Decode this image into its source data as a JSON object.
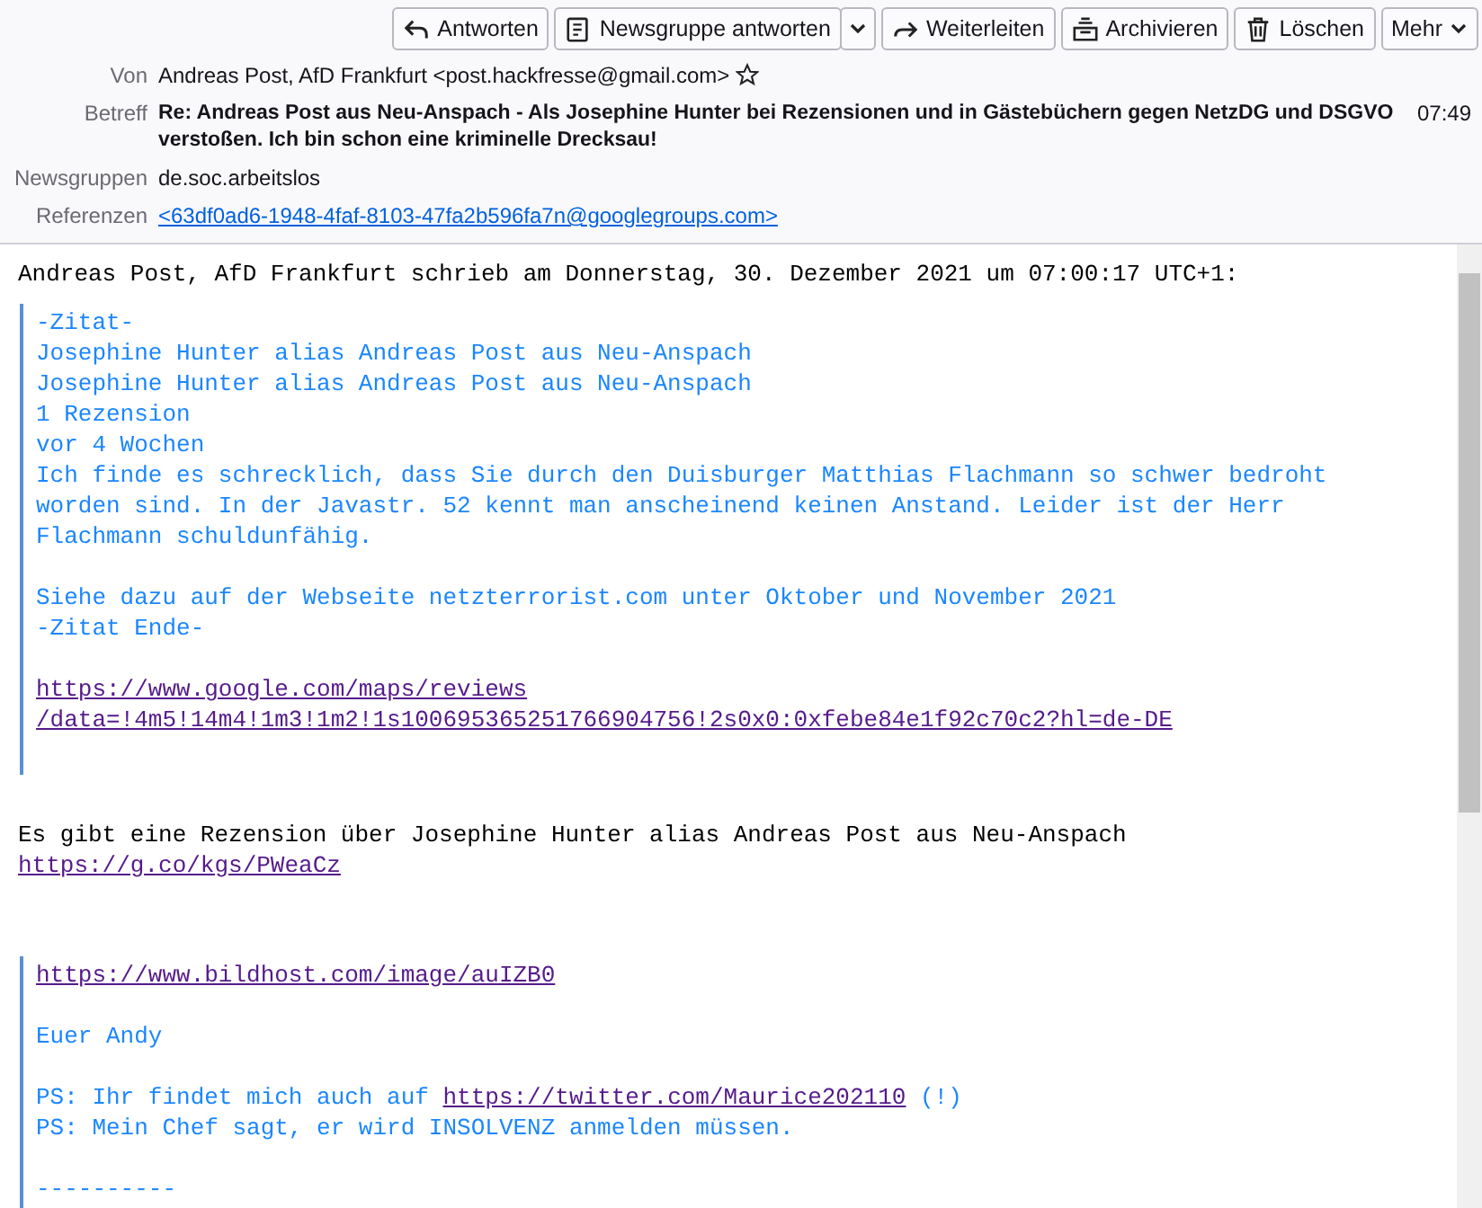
{
  "toolbar": [
    {
      "label": "Antworten"
    },
    {
      "label": "Newsgruppe antworten"
    },
    {
      "label": "Weiterleiten"
    },
    {
      "label": "Archivieren"
    },
    {
      "label": "Löschen"
    },
    {
      "label": "Mehr"
    }
  ],
  "headers": [
    {
      "label": "Von",
      "value": "Andreas Post, AfD Frankfurt <post.hackfresse@gmail.com>",
      "kind": "from",
      "starred": false
    },
    {
      "label": "Betreff",
      "value": "Re: Andreas Post aus Neu-Anspach - Als Josephine Hunter bei Rezensionen und in Gästebüchern gegen NetzDG und DSGVO verstoßen. Ich bin schon eine kriminelle Drecksau!",
      "kind": "subject",
      "time": "07:49"
    },
    {
      "label": "Newsgruppen",
      "value": "de.soc.arbeitslos",
      "kind": "plain"
    },
    {
      "label": "Referenzen",
      "value": "<63df0ad6-1948-4faf-8103-47fa2b596fa7n@googlegroups.com>",
      "kind": "link"
    }
  ],
  "body": [
    {
      "kind": "plain",
      "paragraphs": [
        [
          [
            {
              "text": "Andreas Post, AfD Frankfurt schrieb am Donnerstag, 30. Dezember 2021 um 07:00:17 UTC+1:",
              "kind": "text"
            }
          ]
        ]
      ]
    },
    {
      "kind": "quote",
      "paragraphs": [
        [
          [
            {
              "text": "-Zitat-",
              "kind": "text"
            }
          ],
          [
            {
              "text": "Josephine Hunter alias Andreas Post aus Neu-Anspach",
              "kind": "text"
            }
          ],
          [
            {
              "text": "Josephine Hunter alias Andreas Post aus Neu-Anspach",
              "kind": "text"
            }
          ],
          [
            {
              "text": "1 Rezension",
              "kind": "text"
            }
          ],
          [
            {
              "text": "vor 4 Wochen",
              "kind": "text"
            }
          ],
          [
            {
              "text": "Ich finde es schrecklich, dass Sie durch den Duisburger Matthias Flachmann so schwer bedroht",
              "kind": "text"
            }
          ],
          [
            {
              "text": "worden sind. In der Javastr. 52 kennt man anscheinend keinen Anstand. Leider ist der Herr",
              "kind": "text"
            }
          ],
          [
            {
              "text": "Flachmann schuldunfähig.",
              "kind": "text"
            }
          ]
        ],
        [
          [
            {
              "text": "Siehe dazu auf der Webseite netzterrorist.com unter Oktober und November 2021",
              "kind": "text"
            }
          ],
          [
            {
              "text": "-Zitat Ende-",
              "kind": "text"
            }
          ]
        ],
        [
          [
            {
              "text": "https://www.google.com/maps/reviews",
              "kind": "link"
            }
          ],
          [
            {
              "text": "/data=!4m5!14m4!1m3!1m2!1s100695365251766904756!2s0x0:0xfebe84e1f92c70c2?hl=de-DE",
              "kind": "link"
            }
          ]
        ]
      ]
    },
    {
      "kind": "plain",
      "paragraphs": [
        [
          [
            {
              "text": "Es gibt eine Rezension über Josephine Hunter alias Andreas Post aus Neu-Anspach",
              "kind": "text"
            }
          ],
          [
            {
              "text": "https://g.co/kgs/PWeaCz",
              "kind": "link"
            }
          ]
        ]
      ]
    },
    {
      "kind": "quote",
      "paragraphs": [
        [
          [
            {
              "text": "https://www.bildhost.com/image/auIZB0",
              "kind": "link"
            }
          ]
        ],
        [
          [
            {
              "text": "Euer Andy",
              "kind": "text"
            }
          ]
        ],
        [
          [
            {
              "text": "PS: Ihr findet mich auch auf ",
              "kind": "text"
            },
            {
              "text": "https://twitter.com/Maurice202110",
              "kind": "link"
            },
            {
              "text": " (!)",
              "kind": "text"
            }
          ],
          [
            {
              "text": "PS: Mein Chef sagt, er wird INSOLVENZ anmelden müssen.",
              "kind": "text"
            }
          ]
        ],
        [
          [
            {
              "text": "----------",
              "kind": "text"
            }
          ]
        ]
      ]
    }
  ]
}
